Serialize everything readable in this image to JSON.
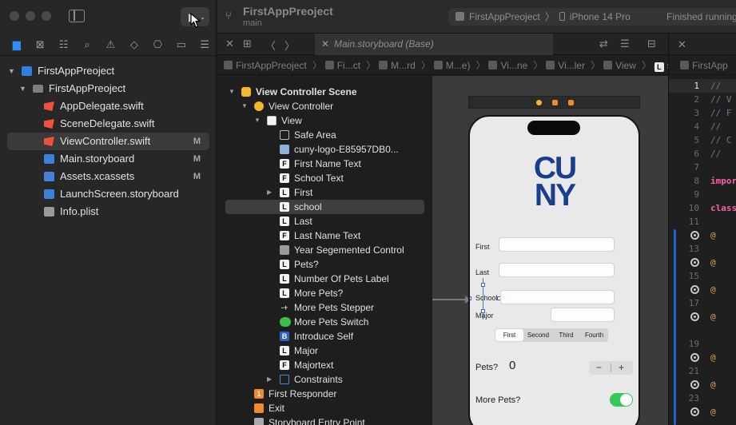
{
  "window": {
    "project": "FirstAppPreoject",
    "branch": "main"
  },
  "scheme": {
    "app": "FirstAppPreoject",
    "device": "iPhone 14 Pro",
    "status": "Finished running"
  },
  "navigator": {
    "tree": [
      {
        "name": "FirstAppPreoject",
        "icon": "xcode-project-icon",
        "level": 0,
        "expanded": true,
        "badge": ""
      },
      {
        "name": "FirstAppPreoject",
        "icon": "folder-icon",
        "level": 1,
        "expanded": true,
        "badge": ""
      },
      {
        "name": "AppDelegate.swift",
        "icon": "swift-file-icon",
        "level": 2,
        "badge": ""
      },
      {
        "name": "SceneDelegate.swift",
        "icon": "swift-file-icon",
        "level": 2,
        "badge": ""
      },
      {
        "name": "ViewController.swift",
        "icon": "swift-file-icon",
        "level": 2,
        "badge": "M",
        "selected": true
      },
      {
        "name": "Main.storyboard",
        "icon": "storyboard-file-icon",
        "level": 2,
        "badge": "M"
      },
      {
        "name": "Assets.xcassets",
        "icon": "asset-catalog-icon",
        "level": 2,
        "badge": "M"
      },
      {
        "name": "LaunchScreen.storyboard",
        "icon": "storyboard-file-icon",
        "level": 2,
        "badge": ""
      },
      {
        "name": "Info.plist",
        "icon": "plist-file-icon",
        "level": 2,
        "badge": ""
      }
    ]
  },
  "editor": {
    "tab_label": "Main.storyboard (Base)",
    "jumpbar": [
      "FirstAppPreoject",
      "Fi...ct",
      "M...rd",
      "M...e)",
      "Vi...ne",
      "Vi...ler",
      "View",
      "school"
    ]
  },
  "outline": {
    "items": [
      {
        "name": "View Controller Scene",
        "icon": "scene-icon",
        "glyph": "",
        "level": 0,
        "disclosure": "open",
        "bold": true
      },
      {
        "name": "View Controller",
        "icon": "view-controller-icon",
        "glyph": "",
        "level": 1,
        "disclosure": "open"
      },
      {
        "name": "View",
        "icon": "view-icon",
        "glyph": "",
        "level": 2,
        "disclosure": "open"
      },
      {
        "name": "Safe Area",
        "icon": "safe-area-icon",
        "glyph": "",
        "level": 3
      },
      {
        "name": "cuny-logo-E85957DB0...",
        "icon": "image-view-icon",
        "glyph": "",
        "level": 3
      },
      {
        "name": "First Name Text",
        "icon": "text-field-icon",
        "glyph": "F",
        "level": 3
      },
      {
        "name": "School Text",
        "icon": "text-field-icon",
        "glyph": "F",
        "level": 3
      },
      {
        "name": "First",
        "icon": "label-icon",
        "glyph": "L",
        "level": 3,
        "disclosure": "closed"
      },
      {
        "name": "school",
        "icon": "label-icon",
        "glyph": "L",
        "level": 3,
        "selected": true
      },
      {
        "name": "Last",
        "icon": "label-icon",
        "glyph": "L",
        "level": 3
      },
      {
        "name": "Last Name Text",
        "icon": "text-field-icon",
        "glyph": "F",
        "level": 3
      },
      {
        "name": "Year Segemented Control",
        "icon": "segmented-control-icon",
        "glyph": "",
        "level": 3
      },
      {
        "name": "Pets?",
        "icon": "label-icon",
        "glyph": "L",
        "level": 3
      },
      {
        "name": "Number Of Pets Label",
        "icon": "label-icon",
        "glyph": "L",
        "level": 3
      },
      {
        "name": "More Pets?",
        "icon": "label-icon",
        "glyph": "L",
        "level": 3
      },
      {
        "name": "More Pets Stepper",
        "icon": "stepper-icon",
        "glyph": "-+",
        "level": 3
      },
      {
        "name": "More Pets Switch",
        "icon": "switch-icon",
        "glyph": "",
        "level": 3
      },
      {
        "name": "Introduce Self",
        "icon": "button-icon",
        "glyph": "B",
        "level": 3
      },
      {
        "name": "Major",
        "icon": "label-icon",
        "glyph": "L",
        "level": 3
      },
      {
        "name": "Majortext",
        "icon": "text-field-icon",
        "glyph": "F",
        "level": 3
      },
      {
        "name": "Constraints",
        "icon": "constraints-icon",
        "glyph": "",
        "level": 3,
        "disclosure": "closed"
      },
      {
        "name": "First Responder",
        "icon": "first-responder-icon",
        "glyph": "1",
        "level": 1
      },
      {
        "name": "Exit",
        "icon": "exit-icon",
        "glyph": "",
        "level": 1
      },
      {
        "name": "Storyboard Entry Point",
        "icon": "entry-point-icon",
        "glyph": "",
        "level": 1
      }
    ]
  },
  "canvas": {
    "logo_line1": "CU",
    "logo_line2": "NY",
    "labels": {
      "first": "First",
      "last": "Last",
      "school": "School",
      "major": "Major"
    },
    "segments": [
      "First",
      "Second",
      "Third",
      "Fourth"
    ],
    "selected_segment": 0,
    "pets_label": "Pets?",
    "pets_count": "0",
    "stepper_minus": "−",
    "stepper_plus": "+",
    "more_pets_label": "More Pets?",
    "switch_on": true
  },
  "code": {
    "file_jump": "FirstApp",
    "lines": [
      {
        "n": "1",
        "src": "//",
        "kind": "comment",
        "current": true
      },
      {
        "n": "2",
        "src": "//  V",
        "kind": "comment"
      },
      {
        "n": "3",
        "src": "//  F",
        "kind": "comment"
      },
      {
        "n": "4",
        "src": "//",
        "kind": "comment"
      },
      {
        "n": "5",
        "src": "//  C",
        "kind": "comment"
      },
      {
        "n": "6",
        "src": "//",
        "kind": "comment"
      },
      {
        "n": "7",
        "src": "",
        "kind": "plain"
      },
      {
        "n": "8",
        "src": "impor",
        "kind": "keyword"
      },
      {
        "n": "9",
        "src": "",
        "kind": "plain"
      },
      {
        "n": "10",
        "src": "class",
        "kind": "keyword"
      },
      {
        "n": "11",
        "src": "",
        "kind": "plain"
      },
      {
        "n": "",
        "src": "@",
        "kind": "attr",
        "breakpoint": true
      },
      {
        "n": "13",
        "src": "",
        "kind": "plain"
      },
      {
        "n": "",
        "src": "@",
        "kind": "attr",
        "breakpoint": true
      },
      {
        "n": "15",
        "src": "",
        "kind": "plain"
      },
      {
        "n": "",
        "src": "@",
        "kind": "attr",
        "breakpoint": true
      },
      {
        "n": "17",
        "src": "",
        "kind": "plain"
      },
      {
        "n": "",
        "src": "@",
        "kind": "attr",
        "breakpoint": true
      },
      {
        "n": "",
        "src": "",
        "kind": "plain"
      },
      {
        "n": "19",
        "src": "",
        "kind": "plain"
      },
      {
        "n": "",
        "src": "@",
        "kind": "attr",
        "breakpoint": true
      },
      {
        "n": "21",
        "src": "",
        "kind": "plain"
      },
      {
        "n": "",
        "src": "@",
        "kind": "attr",
        "breakpoint": true
      },
      {
        "n": "23",
        "src": "",
        "kind": "plain"
      },
      {
        "n": "",
        "src": "@",
        "kind": "attr",
        "breakpoint": true
      }
    ]
  }
}
